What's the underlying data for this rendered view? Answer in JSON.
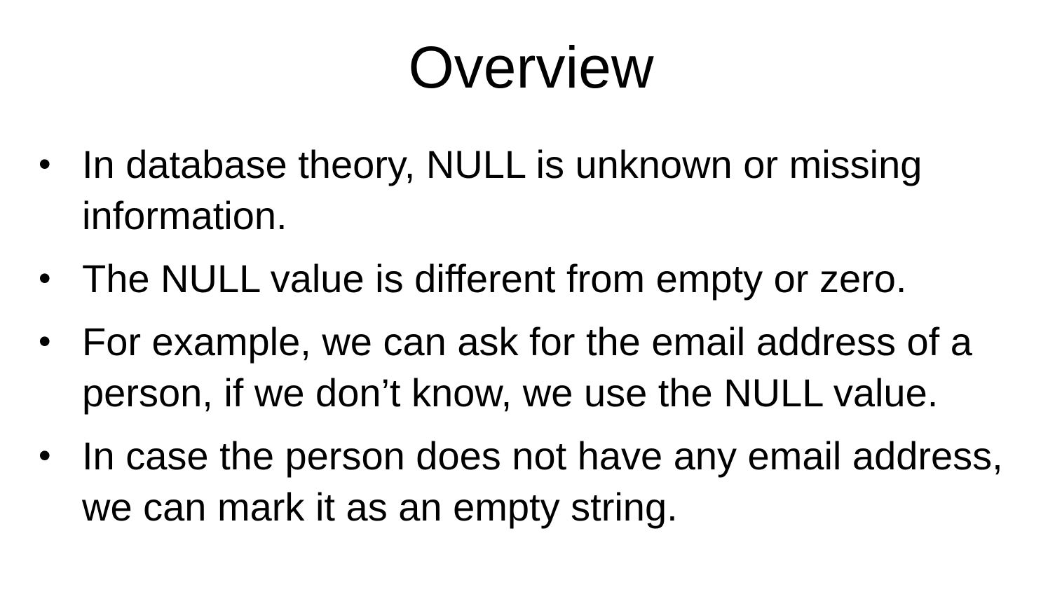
{
  "slide": {
    "title": "Overview",
    "bullet_symbol": "•",
    "bullets": [
      {
        "text": "In database theory, NULL is unknown or missing information."
      },
      {
        "text": "The NULL value is different from empty or zero."
      },
      {
        "text": "For example, we can ask for the email address of a person, if we don’t know, we use the NULL value."
      },
      {
        "text": "In case the person does not have any email address, we can mark it as an empty string."
      }
    ]
  }
}
